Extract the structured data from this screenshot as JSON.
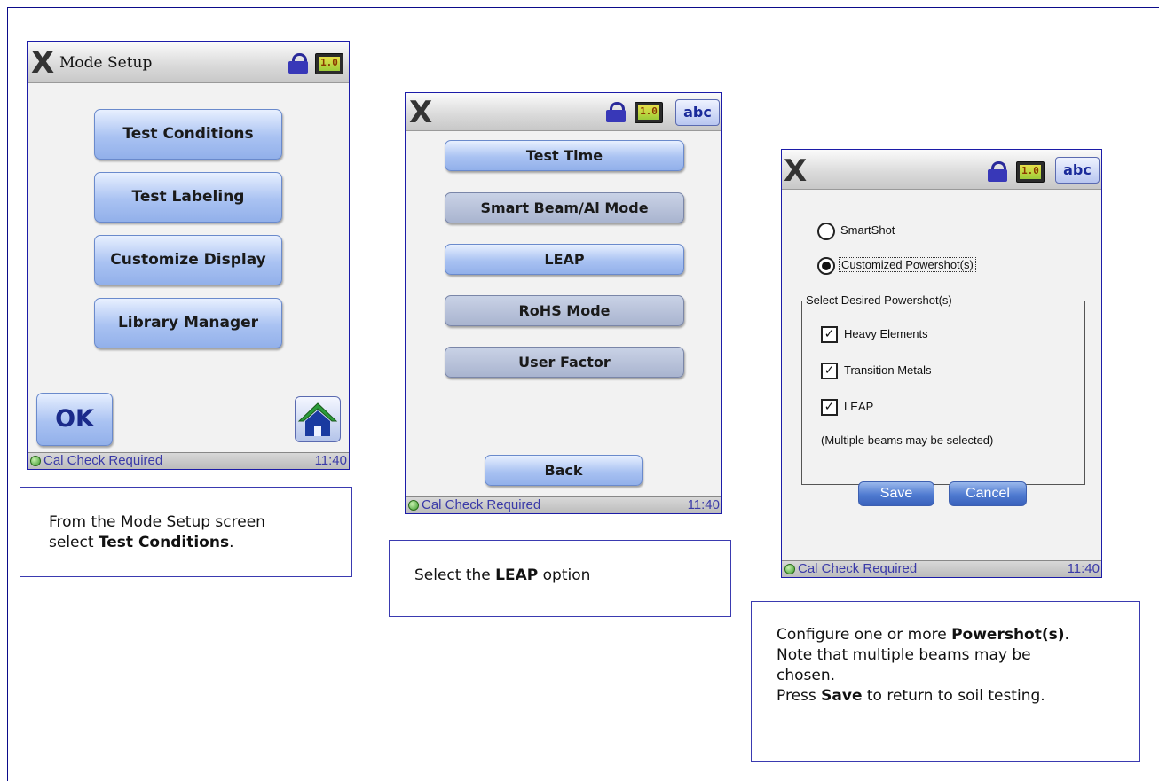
{
  "screen1": {
    "title": "Mode Setup",
    "buttons": [
      "Test Conditions",
      "Test Labeling",
      "Customize Display",
      "Library Manager"
    ],
    "ok_label": "OK",
    "status_message": "Cal Check Required",
    "time": "11:40",
    "battery_label": "1.0"
  },
  "screen2": {
    "buttons": [
      "Test Time",
      "Smart Beam/Al Mode",
      "LEAP",
      "RoHS Mode",
      "User Factor"
    ],
    "back_label": "Back",
    "abc_label": "abc",
    "status_message": "Cal Check Required",
    "time": "11:40",
    "battery_label": "1.0"
  },
  "screen3": {
    "abc_label": "abc",
    "radio_options": [
      "SmartShot",
      "Customized Powershot(s)"
    ],
    "selected_radio": "Customized Powershot(s)",
    "group_label": "Select Desired Powershot(s)",
    "checkboxes": [
      "Heavy Elements",
      "Transition Metals",
      "LEAP"
    ],
    "note": "(Multiple beams may be selected)",
    "save_label": "Save",
    "cancel_label": "Cancel",
    "status_message": "Cal Check Required",
    "time": "11:40",
    "battery_label": "1.0"
  },
  "captions": {
    "caption1": {
      "l1": "From the Mode Setup screen",
      "l2a": "select ",
      "l2b": "Test Conditions",
      "l2c": "."
    },
    "caption2": {
      "a": "Select the ",
      "b": "LEAP",
      "c": " option"
    },
    "caption3": {
      "l1a": "Configure one or more ",
      "l1b": "Powershot(s)",
      "l1c": ".",
      "l2": "Note that multiple beams may be",
      "l3": "chosen.",
      "l4a": "Press ",
      "l4b": "Save",
      "l4c": " to return to soil testing."
    }
  },
  "colors": {
    "frame": "#0b0b8a",
    "button_top": "#e8f0ff",
    "button_bottom": "#92b0ea",
    "status_text": "#3a3aa8"
  }
}
